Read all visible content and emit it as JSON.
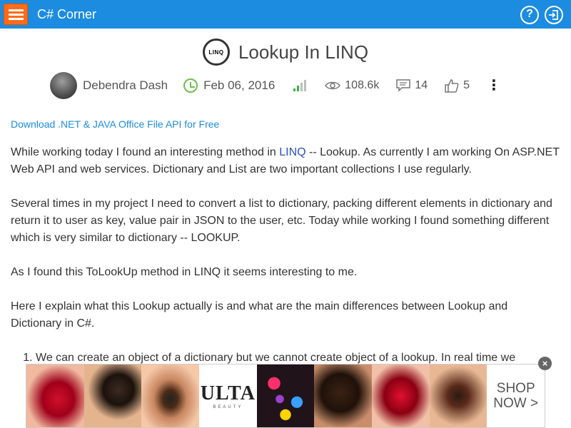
{
  "header": {
    "brand": "C# Corner",
    "menu_icon": "hamburger-menu-icon",
    "help_label": "?",
    "login_icon": "login-icon"
  },
  "article": {
    "logo_text": "LINQ",
    "title": "Lookup In LINQ",
    "author": "Debendra Dash",
    "date": "Feb 06, 2016",
    "views": "108.6k",
    "comments": "14",
    "likes": "5",
    "ad_link": "Download .NET & JAVA Office File API for Free",
    "p1_before": "While working today I found an interesting method in ",
    "p1_link": "LINQ",
    "p1_after": " -- Lookup. As currently I am working On ASP.NET  Web API and web services. Dictionary and List are two important collections I use regularly.",
    "p2": "Several times in my project I need to convert a list to dictionary, packing different elements in dictionary and return it to user as key, value pair in JSON to the user, etc. Today while working I found something different which is very similar to dictionary  -- LOOKUP.",
    "p3": "As I found this ToLookUp method in LINQ it seems interesting to me.",
    "p4": "Here I explain what this Lookup actually is and what are the main differences between Lookup and Dictionary in C#.",
    "list_item_1": "We can create an object of a dictionary but we cannot create object of a lookup. In real time we"
  },
  "ad": {
    "brand": "ULTA",
    "brand_sub": "BEAUTY",
    "cta_line1": "SHOP",
    "cta_line2": "NOW >",
    "close_label": "×"
  },
  "colors": {
    "header_bg": "#1b8ce0",
    "menu_button": "#ff6c1a",
    "link": "#1b8ce0",
    "inline_link": "#2a52be"
  }
}
